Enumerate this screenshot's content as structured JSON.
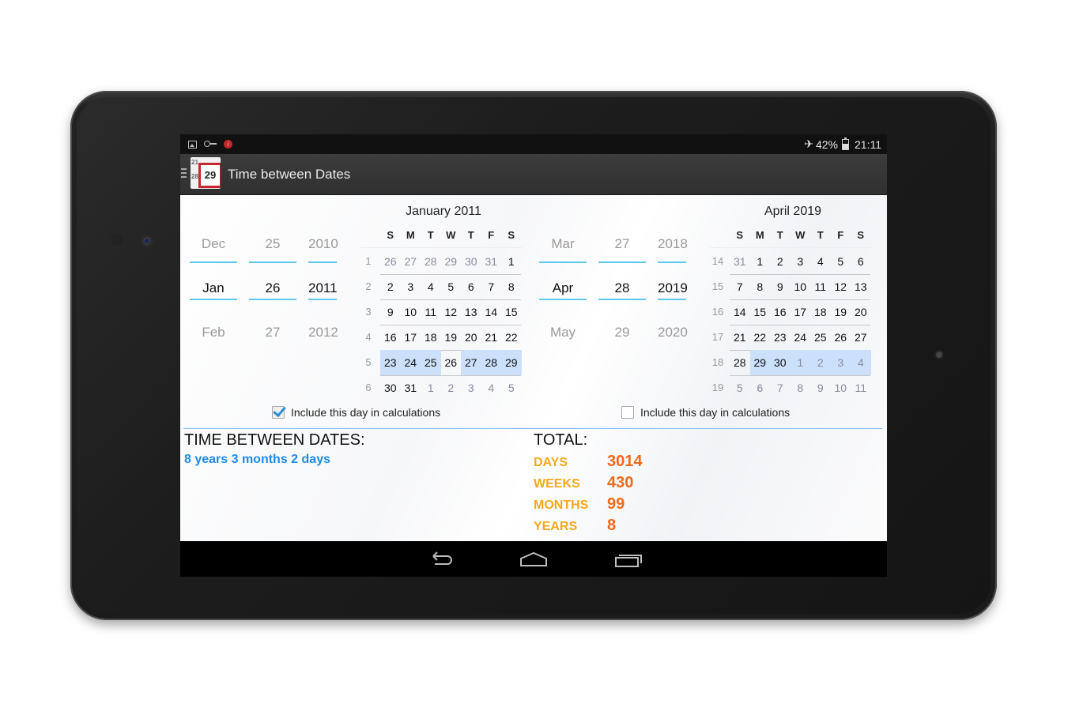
{
  "status_bar": {
    "notification_icons": [
      "image-icon",
      "key-icon",
      "alert-icon"
    ],
    "airplane_icon": "airplane-icon",
    "battery": "42%",
    "time": "21:11"
  },
  "action_bar": {
    "menu_icon": "hamburger-icon",
    "app_icon_small_numbers": [
      "21",
      "28"
    ],
    "app_icon_number": "29",
    "title": "Time between Dates"
  },
  "weekday_headers": [
    "S",
    "M",
    "T",
    "W",
    "T",
    "F",
    "S"
  ],
  "start": {
    "picker": {
      "month": {
        "prev": "Dec",
        "current": "Jan",
        "next": "Feb"
      },
      "day": {
        "prev": "25",
        "current": "26",
        "next": "27"
      },
      "year": {
        "prev": "2010",
        "current": "2011",
        "next": "2012"
      }
    },
    "calendar": {
      "title": "January 2011",
      "weeks": [
        {
          "num": "1",
          "days": [
            [
              "26",
              "o"
            ],
            [
              "27",
              "o"
            ],
            [
              "28",
              "o"
            ],
            [
              "29",
              "o"
            ],
            [
              "30",
              "o"
            ],
            [
              "31",
              "o"
            ],
            [
              "1",
              ""
            ]
          ]
        },
        {
          "num": "2",
          "days": [
            [
              "2",
              ""
            ],
            [
              "3",
              ""
            ],
            [
              "4",
              ""
            ],
            [
              "5",
              ""
            ],
            [
              "6",
              ""
            ],
            [
              "7",
              ""
            ],
            [
              "8",
              ""
            ]
          ]
        },
        {
          "num": "3",
          "days": [
            [
              "9",
              ""
            ],
            [
              "10",
              ""
            ],
            [
              "11",
              ""
            ],
            [
              "12",
              ""
            ],
            [
              "13",
              ""
            ],
            [
              "14",
              ""
            ],
            [
              "15",
              ""
            ]
          ]
        },
        {
          "num": "4",
          "days": [
            [
              "16",
              ""
            ],
            [
              "17",
              ""
            ],
            [
              "18",
              ""
            ],
            [
              "19",
              ""
            ],
            [
              "20",
              ""
            ],
            [
              "21",
              ""
            ],
            [
              "22",
              ""
            ]
          ]
        },
        {
          "num": "5",
          "days": [
            [
              "23",
              "h"
            ],
            [
              "24",
              "h"
            ],
            [
              "25",
              "h"
            ],
            [
              "26",
              "s"
            ],
            [
              "27",
              "h"
            ],
            [
              "28",
              "h"
            ],
            [
              "29",
              "h"
            ]
          ]
        },
        {
          "num": "6",
          "days": [
            [
              "30",
              ""
            ],
            [
              "31",
              ""
            ],
            [
              "1",
              "o"
            ],
            [
              "2",
              "o"
            ],
            [
              "3",
              "o"
            ],
            [
              "4",
              "o"
            ],
            [
              "5",
              "o"
            ]
          ]
        }
      ]
    },
    "include_day": {
      "label": "Include this day in calculations",
      "checked": true
    }
  },
  "end": {
    "picker": {
      "month": {
        "prev": "Mar",
        "current": "Apr",
        "next": "May"
      },
      "day": {
        "prev": "27",
        "current": "28",
        "next": "29"
      },
      "year": {
        "prev": "2018",
        "current": "2019",
        "next": "2020"
      }
    },
    "calendar": {
      "title": "April 2019",
      "weeks": [
        {
          "num": "14",
          "days": [
            [
              "31",
              "o"
            ],
            [
              "1",
              ""
            ],
            [
              "2",
              ""
            ],
            [
              "3",
              ""
            ],
            [
              "4",
              ""
            ],
            [
              "5",
              ""
            ],
            [
              "6",
              ""
            ]
          ]
        },
        {
          "num": "15",
          "days": [
            [
              "7",
              ""
            ],
            [
              "8",
              ""
            ],
            [
              "9",
              ""
            ],
            [
              "10",
              ""
            ],
            [
              "11",
              ""
            ],
            [
              "12",
              ""
            ],
            [
              "13",
              ""
            ]
          ]
        },
        {
          "num": "16",
          "days": [
            [
              "14",
              ""
            ],
            [
              "15",
              ""
            ],
            [
              "16",
              ""
            ],
            [
              "17",
              ""
            ],
            [
              "18",
              ""
            ],
            [
              "19",
              ""
            ],
            [
              "20",
              ""
            ]
          ]
        },
        {
          "num": "17",
          "days": [
            [
              "21",
              ""
            ],
            [
              "22",
              ""
            ],
            [
              "23",
              ""
            ],
            [
              "24",
              ""
            ],
            [
              "25",
              ""
            ],
            [
              "26",
              ""
            ],
            [
              "27",
              ""
            ]
          ]
        },
        {
          "num": "18",
          "days": [
            [
              "28",
              "s"
            ],
            [
              "29",
              "h"
            ],
            [
              "30",
              "h"
            ],
            [
              "1",
              "ho"
            ],
            [
              "2",
              "ho"
            ],
            [
              "3",
              "ho"
            ],
            [
              "4",
              "ho"
            ]
          ]
        },
        {
          "num": "19",
          "days": [
            [
              "5",
              "o"
            ],
            [
              "6",
              "o"
            ],
            [
              "7",
              "o"
            ],
            [
              "8",
              "o"
            ],
            [
              "9",
              "o"
            ],
            [
              "10",
              "o"
            ],
            [
              "11",
              "o"
            ]
          ]
        }
      ]
    },
    "include_day": {
      "label": "Include this day in calculations",
      "checked": false
    }
  },
  "result": {
    "title": "TIME BETWEEN DATES:",
    "value": "8 years 3 months 2 days"
  },
  "total": {
    "title": "TOTAL:",
    "rows": [
      {
        "label": "DAYS",
        "value": "3014"
      },
      {
        "label": "WEEKS",
        "value": "430"
      },
      {
        "label": "MONTHS",
        "value": "99"
      },
      {
        "label": "YEARS",
        "value": "8"
      }
    ]
  },
  "nav_bar": {
    "buttons": [
      "back-icon",
      "home-icon",
      "recent-apps-icon"
    ]
  },
  "colors": {
    "accent_blue": "#1f8ae6",
    "picker_line": "#5ec8ee",
    "highlight": "#cce0fb",
    "total_label": "#f6a81a",
    "total_value": "#f06a1a",
    "app_icon_red": "#c7272d"
  }
}
